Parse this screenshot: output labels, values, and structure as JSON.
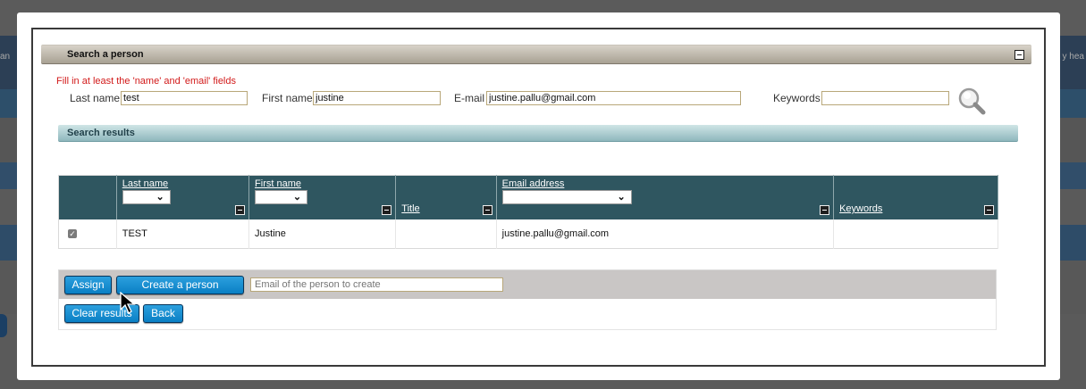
{
  "background": {
    "left_text": "an",
    "right_text": "y hea"
  },
  "panel": {
    "title": "Search a person"
  },
  "form": {
    "hint": "Fill in at least the 'name' and 'email' fields",
    "last_name_label": "Last name",
    "last_name_value": "test",
    "first_name_label": "First name",
    "first_name_value": "justine",
    "email_label": "E-mail",
    "email_value": "justine.pallu@gmail.com",
    "keywords_label": "Keywords",
    "keywords_value": ""
  },
  "results": {
    "title": "Search results",
    "columns": [
      "",
      "Last name",
      "First name",
      "Title",
      "Email address",
      "Keywords"
    ],
    "rows": [
      {
        "checked": true,
        "last_name": "TEST",
        "first_name": "Justine",
        "title": "",
        "email": "justine.pallu@gmail.com",
        "keywords": ""
      }
    ]
  },
  "actions": {
    "assign": "Assign",
    "create_person": "Create a person",
    "email_placeholder": "Email of the person to create",
    "clear_results": "Clear results",
    "back": "Back"
  },
  "colors": {
    "panel_header": "#a8a193",
    "results_header": "#8fb7bd",
    "table_header": "#2f5660",
    "button": "#0a7fc4",
    "hint": "#d21a1a"
  },
  "icons": {
    "search": "magnifier-icon",
    "collapse": "collapse-icon",
    "cursor": "mouse-pointer-icon"
  }
}
